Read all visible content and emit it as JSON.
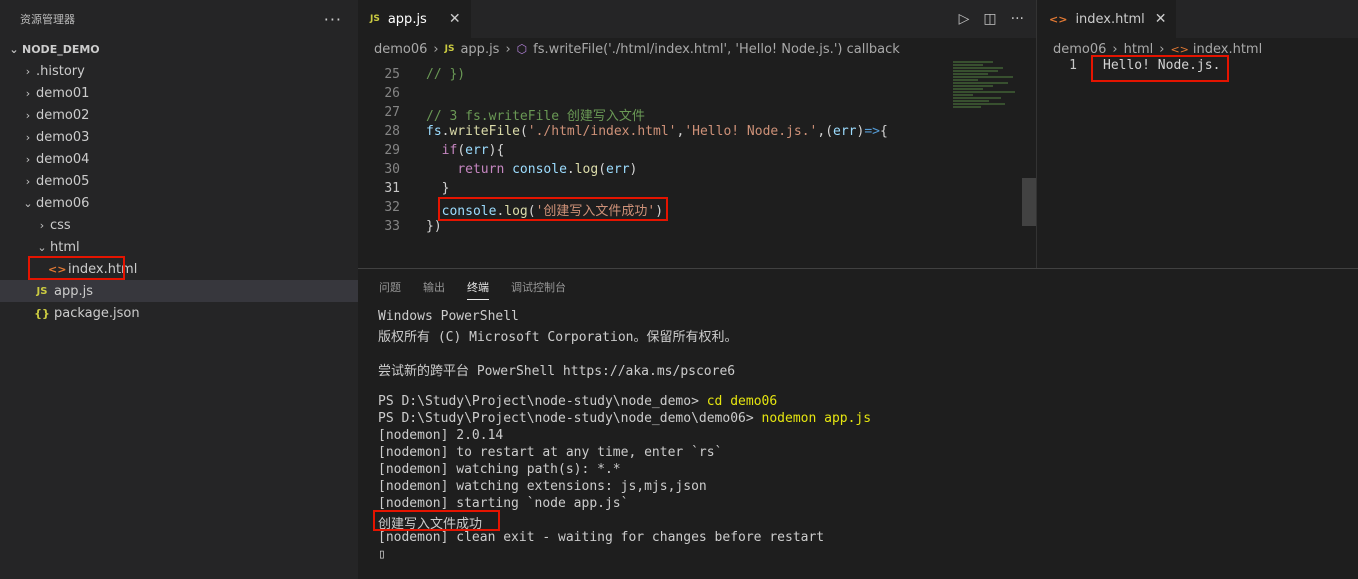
{
  "explorer": {
    "title": "资源管理器",
    "more": "···",
    "root": "NODE_DEMO",
    "items": [
      {
        "label": ".history",
        "chev": "›",
        "indent": 1
      },
      {
        "label": "demo01",
        "chev": "›",
        "indent": 1
      },
      {
        "label": "demo02",
        "chev": "›",
        "indent": 1
      },
      {
        "label": "demo03",
        "chev": "›",
        "indent": 1
      },
      {
        "label": "demo04",
        "chev": "›",
        "indent": 1
      },
      {
        "label": "demo05",
        "chev": "›",
        "indent": 1
      },
      {
        "label": "demo06",
        "chev": "⌄",
        "indent": 1
      },
      {
        "label": "css",
        "chev": "›",
        "indent": 2
      },
      {
        "label": "html",
        "chev": "⌄",
        "indent": 2
      },
      {
        "label": "index.html",
        "icon": "<>",
        "indent": 3
      },
      {
        "label": "app.js",
        "icon": "JS",
        "indent": 2
      },
      {
        "label": "package.json",
        "icon": "{}",
        "indent": 2
      }
    ]
  },
  "editor": {
    "tab": {
      "icon": "JS",
      "label": "app.js",
      "close": "✕"
    },
    "actions": {
      "run": "▷",
      "split": "◫",
      "more": "···"
    },
    "breadcrumb": [
      "demo06",
      "app.js",
      "fs.writeFile('./html/index.html', 'Hello! Node.js.') callback"
    ],
    "lines": [
      {
        "n": "25",
        "text": "// })"
      },
      {
        "n": "26",
        "text": ""
      },
      {
        "n": "27",
        "text": "// 3 fs.writeFile 创建写入文件"
      },
      {
        "n": "28",
        "parts": [
          "fs",
          ".",
          "writeFile",
          "(",
          "'./html/index.html'",
          ",",
          "'Hello! Node.js.'",
          ",(",
          "err",
          ")",
          "=>",
          "{"
        ]
      },
      {
        "n": "29",
        "parts": [
          "  ",
          "if",
          "(",
          "err",
          "){"
        ]
      },
      {
        "n": "30",
        "parts": [
          "    ",
          "return",
          " ",
          "console",
          ".",
          "log",
          "(",
          "err",
          ")"
        ]
      },
      {
        "n": "31",
        "text": "  }"
      },
      {
        "n": "32",
        "parts": [
          "  ",
          "console",
          ".",
          "log",
          "(",
          "'创建写入文件成功'",
          ")"
        ]
      },
      {
        "n": "33",
        "text": "})"
      }
    ]
  },
  "preview": {
    "tab": {
      "icon": "<>",
      "label": "index.html",
      "close": "✕"
    },
    "breadcrumb": [
      "demo06",
      "html",
      "index.html"
    ],
    "line_number": "1",
    "line_text": "Hello! Node.js."
  },
  "panel": {
    "tabs": [
      "问题",
      "输出",
      "终端",
      "调试控制台"
    ],
    "active_tab": "终端",
    "terminal": [
      "Windows PowerShell",
      "版权所有 (C) Microsoft Corporation。保留所有权利。",
      "",
      "尝试新的跨平台 PowerShell https://aka.ms/pscore6",
      "",
      "PS D:\\Study\\Project\\node-study\\node_demo> ",
      "PS D:\\Study\\Project\\node-study\\node_demo\\demo06> ",
      "[nodemon] 2.0.14",
      "[nodemon] to restart at any time, enter `rs`",
      "[nodemon] watching path(s): *.*",
      "[nodemon] watching extensions: js,mjs,json",
      "[nodemon] starting `node app.js`",
      "创建写入文件成功",
      "[nodemon] clean exit - waiting for changes before restart"
    ],
    "cmd1": "cd demo06",
    "cmd2": "nodemon app.js",
    "cursor": "▯"
  }
}
